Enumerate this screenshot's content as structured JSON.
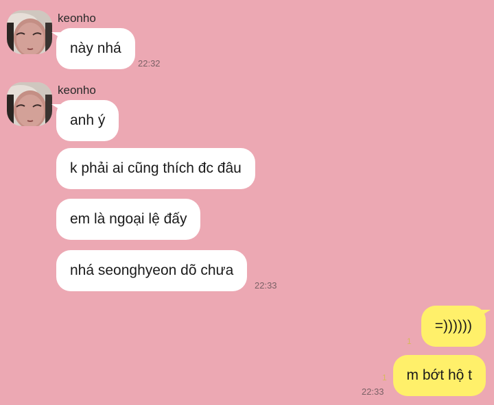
{
  "messages": [
    {
      "sender": "keonho",
      "text": "này nhá",
      "time": "22:32",
      "avatar_icon": "profile-photo"
    },
    {
      "sender": "keonho",
      "text": "anh ý"
    },
    {
      "text": "k phải ai cũng thích đc đâu"
    },
    {
      "text": "em là ngoại lệ đấy"
    },
    {
      "text": "nhá seonghyeon dõ chưa",
      "time": "22:33"
    },
    {
      "text": "=))))))",
      "unread": "1",
      "outgoing": true
    },
    {
      "text": "m bớt hộ t",
      "unread": "1",
      "time": "22:33",
      "outgoing": true
    }
  ],
  "colors": {
    "background": "#eca8b3",
    "incoming_bubble": "#ffffff",
    "outgoing_bubble": "#fff06a",
    "unread_count": "#d8b85a"
  }
}
